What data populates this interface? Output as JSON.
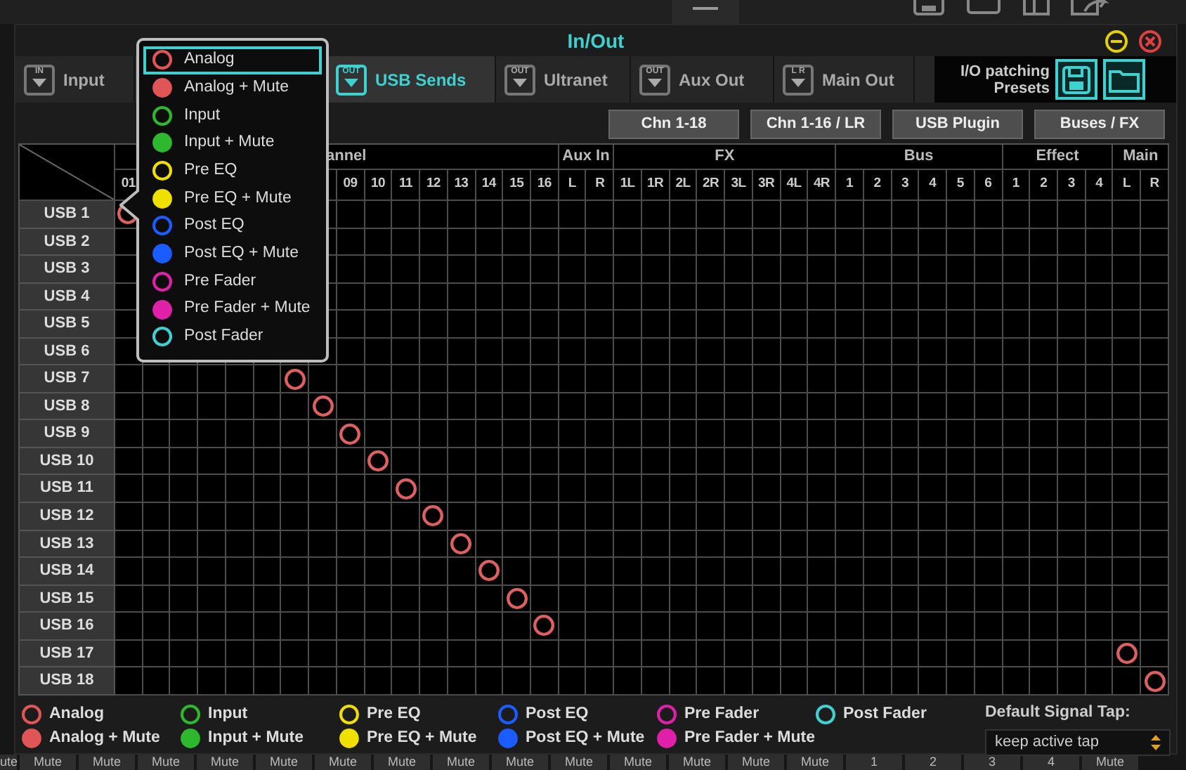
{
  "window": {
    "title": "In/Out"
  },
  "tabs": [
    {
      "label": "Input",
      "icon_text": "IN",
      "selected": false
    },
    {
      "label": "USB Sends",
      "icon_text": "OUT",
      "selected": true
    },
    {
      "label": "Ultranet",
      "icon_text": "OUT",
      "selected": false
    },
    {
      "label": "Aux Out",
      "icon_text": "OUT",
      "selected": false
    },
    {
      "label": "Main Out",
      "icon_text": "L R",
      "selected": false
    }
  ],
  "presets": {
    "label": "I/O patching Presets"
  },
  "view_buttons": [
    "Chn 1-18",
    "Chn 1-16 / LR",
    "USB Plugin",
    "Buses / FX"
  ],
  "matrix": {
    "groups": [
      {
        "label": "annel",
        "columns": [
          {
            "label": "01"
          },
          {},
          {},
          {},
          {},
          {},
          {},
          {},
          {
            "label": "09"
          },
          {
            "label": "10"
          },
          {
            "label": "11"
          },
          {
            "label": "12"
          },
          {
            "label": "13"
          },
          {
            "label": "14"
          },
          {
            "label": "15"
          },
          {
            "label": "16"
          }
        ]
      },
      {
        "label": "Aux In",
        "columns": [
          {
            "label": "L"
          },
          {
            "label": "R"
          }
        ]
      },
      {
        "label": "FX",
        "columns": [
          {
            "label": "1L"
          },
          {
            "label": "1R"
          },
          {
            "label": "2L"
          },
          {
            "label": "2R"
          },
          {
            "label": "3L"
          },
          {
            "label": "3R"
          },
          {
            "label": "4L"
          },
          {
            "label": "4R"
          }
        ]
      },
      {
        "label": "Bus",
        "columns": [
          {
            "label": "1"
          },
          {
            "label": "2"
          },
          {
            "label": "3"
          },
          {
            "label": "4"
          },
          {
            "label": "5"
          },
          {
            "label": "6"
          }
        ]
      },
      {
        "label": "Effect",
        "columns": [
          {
            "label": "1"
          },
          {
            "label": "2"
          },
          {
            "label": "3"
          },
          {
            "label": "4"
          }
        ]
      },
      {
        "label": "Main",
        "columns": [
          {
            "label": "L"
          },
          {
            "label": "R"
          }
        ]
      }
    ],
    "rows": [
      {
        "label": "USB 1",
        "cells": [
          true,
          null,
          null,
          null,
          null,
          null,
          null,
          false,
          false,
          false,
          false,
          false,
          false,
          false,
          false,
          false,
          false,
          false,
          false,
          false,
          false,
          false,
          false,
          false,
          false,
          false,
          false,
          false,
          false,
          false,
          false,
          false,
          false,
          false,
          false,
          false,
          false,
          false
        ]
      },
      {
        "label": "USB 2",
        "cells": [
          false,
          null,
          null,
          null,
          null,
          null,
          null,
          false,
          false,
          false,
          false,
          false,
          false,
          false,
          false,
          false,
          false,
          false,
          false,
          false,
          false,
          false,
          false,
          false,
          false,
          false,
          false,
          false,
          false,
          false,
          false,
          false,
          false,
          false,
          false,
          false,
          false,
          false
        ]
      },
      {
        "label": "USB 3",
        "cells": [
          false,
          null,
          null,
          null,
          null,
          null,
          null,
          false,
          false,
          false,
          false,
          false,
          false,
          false,
          false,
          false,
          false,
          false,
          false,
          false,
          false,
          false,
          false,
          false,
          false,
          false,
          false,
          false,
          false,
          false,
          false,
          false,
          false,
          false,
          false,
          false,
          false,
          false
        ]
      },
      {
        "label": "USB 4",
        "cells": [
          false,
          null,
          null,
          null,
          null,
          null,
          null,
          false,
          false,
          false,
          false,
          false,
          false,
          false,
          false,
          false,
          false,
          false,
          false,
          false,
          false,
          false,
          false,
          false,
          false,
          false,
          false,
          false,
          false,
          false,
          false,
          false,
          false,
          false,
          false,
          false,
          false,
          false
        ]
      },
      {
        "label": "USB 5",
        "cells": [
          false,
          null,
          null,
          null,
          null,
          null,
          null,
          false,
          false,
          false,
          false,
          false,
          false,
          false,
          false,
          false,
          false,
          false,
          false,
          false,
          false,
          false,
          false,
          false,
          false,
          false,
          false,
          false,
          false,
          false,
          false,
          false,
          false,
          false,
          false,
          false,
          false,
          false
        ]
      },
      {
        "label": "USB 6",
        "cells": [
          false,
          null,
          null,
          null,
          null,
          null,
          null,
          false,
          false,
          false,
          false,
          false,
          false,
          false,
          false,
          false,
          false,
          false,
          false,
          false,
          false,
          false,
          false,
          false,
          false,
          false,
          false,
          false,
          false,
          false,
          false,
          false,
          false,
          false,
          false,
          false,
          false,
          false
        ]
      },
      {
        "label": "USB 7",
        "cells": [
          false,
          false,
          false,
          false,
          false,
          false,
          true,
          false,
          false,
          false,
          false,
          false,
          false,
          false,
          false,
          false,
          false,
          false,
          false,
          false,
          false,
          false,
          false,
          false,
          false,
          false,
          false,
          false,
          false,
          false,
          false,
          false,
          false,
          false,
          false,
          false,
          false,
          false
        ]
      },
      {
        "label": "USB 8",
        "cells": [
          false,
          false,
          false,
          false,
          false,
          false,
          false,
          true,
          false,
          false,
          false,
          false,
          false,
          false,
          false,
          false,
          false,
          false,
          false,
          false,
          false,
          false,
          false,
          false,
          false,
          false,
          false,
          false,
          false,
          false,
          false,
          false,
          false,
          false,
          false,
          false,
          false,
          false
        ]
      },
      {
        "label": "USB 9",
        "cells": [
          false,
          false,
          false,
          false,
          false,
          false,
          false,
          false,
          true,
          false,
          false,
          false,
          false,
          false,
          false,
          false,
          false,
          false,
          false,
          false,
          false,
          false,
          false,
          false,
          false,
          false,
          false,
          false,
          false,
          false,
          false,
          false,
          false,
          false,
          false,
          false,
          false,
          false
        ]
      },
      {
        "label": "USB 10",
        "cells": [
          false,
          false,
          false,
          false,
          false,
          false,
          false,
          false,
          false,
          true,
          false,
          false,
          false,
          false,
          false,
          false,
          false,
          false,
          false,
          false,
          false,
          false,
          false,
          false,
          false,
          false,
          false,
          false,
          false,
          false,
          false,
          false,
          false,
          false,
          false,
          false,
          false,
          false
        ]
      },
      {
        "label": "USB 11",
        "cells": [
          false,
          false,
          false,
          false,
          false,
          false,
          false,
          false,
          false,
          false,
          true,
          false,
          false,
          false,
          false,
          false,
          false,
          false,
          false,
          false,
          false,
          false,
          false,
          false,
          false,
          false,
          false,
          false,
          false,
          false,
          false,
          false,
          false,
          false,
          false,
          false,
          false,
          false
        ]
      },
      {
        "label": "USB 12",
        "cells": [
          false,
          false,
          false,
          false,
          false,
          false,
          false,
          false,
          false,
          false,
          false,
          true,
          false,
          false,
          false,
          false,
          false,
          false,
          false,
          false,
          false,
          false,
          false,
          false,
          false,
          false,
          false,
          false,
          false,
          false,
          false,
          false,
          false,
          false,
          false,
          false,
          false,
          false
        ]
      },
      {
        "label": "USB 13",
        "cells": [
          false,
          false,
          false,
          false,
          false,
          false,
          false,
          false,
          false,
          false,
          false,
          false,
          true,
          false,
          false,
          false,
          false,
          false,
          false,
          false,
          false,
          false,
          false,
          false,
          false,
          false,
          false,
          false,
          false,
          false,
          false,
          false,
          false,
          false,
          false,
          false,
          false,
          false
        ]
      },
      {
        "label": "USB 14",
        "cells": [
          false,
          false,
          false,
          false,
          false,
          false,
          false,
          false,
          false,
          false,
          false,
          false,
          false,
          true,
          false,
          false,
          false,
          false,
          false,
          false,
          false,
          false,
          false,
          false,
          false,
          false,
          false,
          false,
          false,
          false,
          false,
          false,
          false,
          false,
          false,
          false,
          false,
          false
        ]
      },
      {
        "label": "USB 15",
        "cells": [
          false,
          false,
          false,
          false,
          false,
          false,
          false,
          false,
          false,
          false,
          false,
          false,
          false,
          false,
          true,
          false,
          false,
          false,
          false,
          false,
          false,
          false,
          false,
          false,
          false,
          false,
          false,
          false,
          false,
          false,
          false,
          false,
          false,
          false,
          false,
          false,
          false,
          false
        ]
      },
      {
        "label": "USB 16",
        "cells": [
          false,
          false,
          false,
          false,
          false,
          false,
          false,
          false,
          false,
          false,
          false,
          false,
          false,
          false,
          false,
          true,
          false,
          false,
          false,
          false,
          false,
          false,
          false,
          false,
          false,
          false,
          false,
          false,
          false,
          false,
          false,
          false,
          false,
          false,
          false,
          false,
          false,
          false
        ]
      },
      {
        "label": "USB 17",
        "cells": [
          false,
          false,
          false,
          false,
          false,
          false,
          false,
          false,
          false,
          false,
          false,
          false,
          false,
          false,
          false,
          false,
          false,
          false,
          false,
          false,
          false,
          false,
          false,
          false,
          false,
          false,
          false,
          false,
          false,
          false,
          false,
          false,
          false,
          false,
          false,
          false,
          true,
          false
        ]
      },
      {
        "label": "USB 18",
        "cells": [
          false,
          false,
          false,
          false,
          false,
          false,
          false,
          false,
          false,
          false,
          false,
          false,
          false,
          false,
          false,
          false,
          false,
          false,
          false,
          false,
          false,
          false,
          false,
          false,
          false,
          false,
          false,
          false,
          false,
          false,
          false,
          false,
          false,
          false,
          false,
          false,
          false,
          true
        ]
      }
    ]
  },
  "popup": {
    "items": [
      {
        "label": "Analog",
        "color": "#e05555",
        "filled": false,
        "selected": true
      },
      {
        "label": "Analog + Mute",
        "color": "#e05555",
        "filled": true,
        "selected": false
      },
      {
        "label": "Input",
        "color": "#2db82d",
        "filled": false,
        "selected": false
      },
      {
        "label": "Input + Mute",
        "color": "#2db82d",
        "filled": true,
        "selected": false
      },
      {
        "label": "Pre EQ",
        "color": "#f0e000",
        "filled": false,
        "selected": false
      },
      {
        "label": "Pre EQ + Mute",
        "color": "#f0e000",
        "filled": true,
        "selected": false
      },
      {
        "label": "Post EQ",
        "color": "#1a5cff",
        "filled": false,
        "selected": false
      },
      {
        "label": "Post EQ + Mute",
        "color": "#1a5cff",
        "filled": true,
        "selected": false
      },
      {
        "label": "Pre Fader",
        "color": "#e020a8",
        "filled": false,
        "selected": false
      },
      {
        "label": "Pre Fader + Mute",
        "color": "#e020a8",
        "filled": true,
        "selected": false
      },
      {
        "label": "Post Fader",
        "color": "#40d0d0",
        "filled": false,
        "selected": false
      }
    ]
  },
  "legend": {
    "items": [
      {
        "label": "Analog",
        "color": "#e05555",
        "filled": false
      },
      {
        "label": "Input",
        "color": "#2db82d",
        "filled": false
      },
      {
        "label": "Pre EQ",
        "color": "#f0e000",
        "filled": false
      },
      {
        "label": "Post EQ",
        "color": "#1a5cff",
        "filled": false
      },
      {
        "label": "Pre Fader",
        "color": "#e020a8",
        "filled": false
      },
      {
        "label": "Post Fader",
        "color": "#40d0d0",
        "filled": false
      },
      {
        "label": "Analog + Mute",
        "color": "#e05555",
        "filled": true
      },
      {
        "label": "Input + Mute",
        "color": "#2db82d",
        "filled": true
      },
      {
        "label": "Pre EQ + Mute",
        "color": "#f0e000",
        "filled": true
      },
      {
        "label": "Post EQ + Mute",
        "color": "#1a5cff",
        "filled": true
      },
      {
        "label": "Pre Fader + Mute",
        "color": "#e020a8",
        "filled": true
      }
    ],
    "default_tap_label": "Default Signal Tap:",
    "default_tap_value": "keep active tap"
  },
  "background_buttons": [
    "ute",
    "Mute",
    "Mute",
    "Mute",
    "Mute",
    "Mute",
    "Mute",
    "Mute",
    "Mute",
    "Mute",
    "Mute",
    "Mute",
    "Mute",
    "Mute",
    "Mute",
    "1",
    "2",
    "3",
    "4",
    "Mute"
  ]
}
